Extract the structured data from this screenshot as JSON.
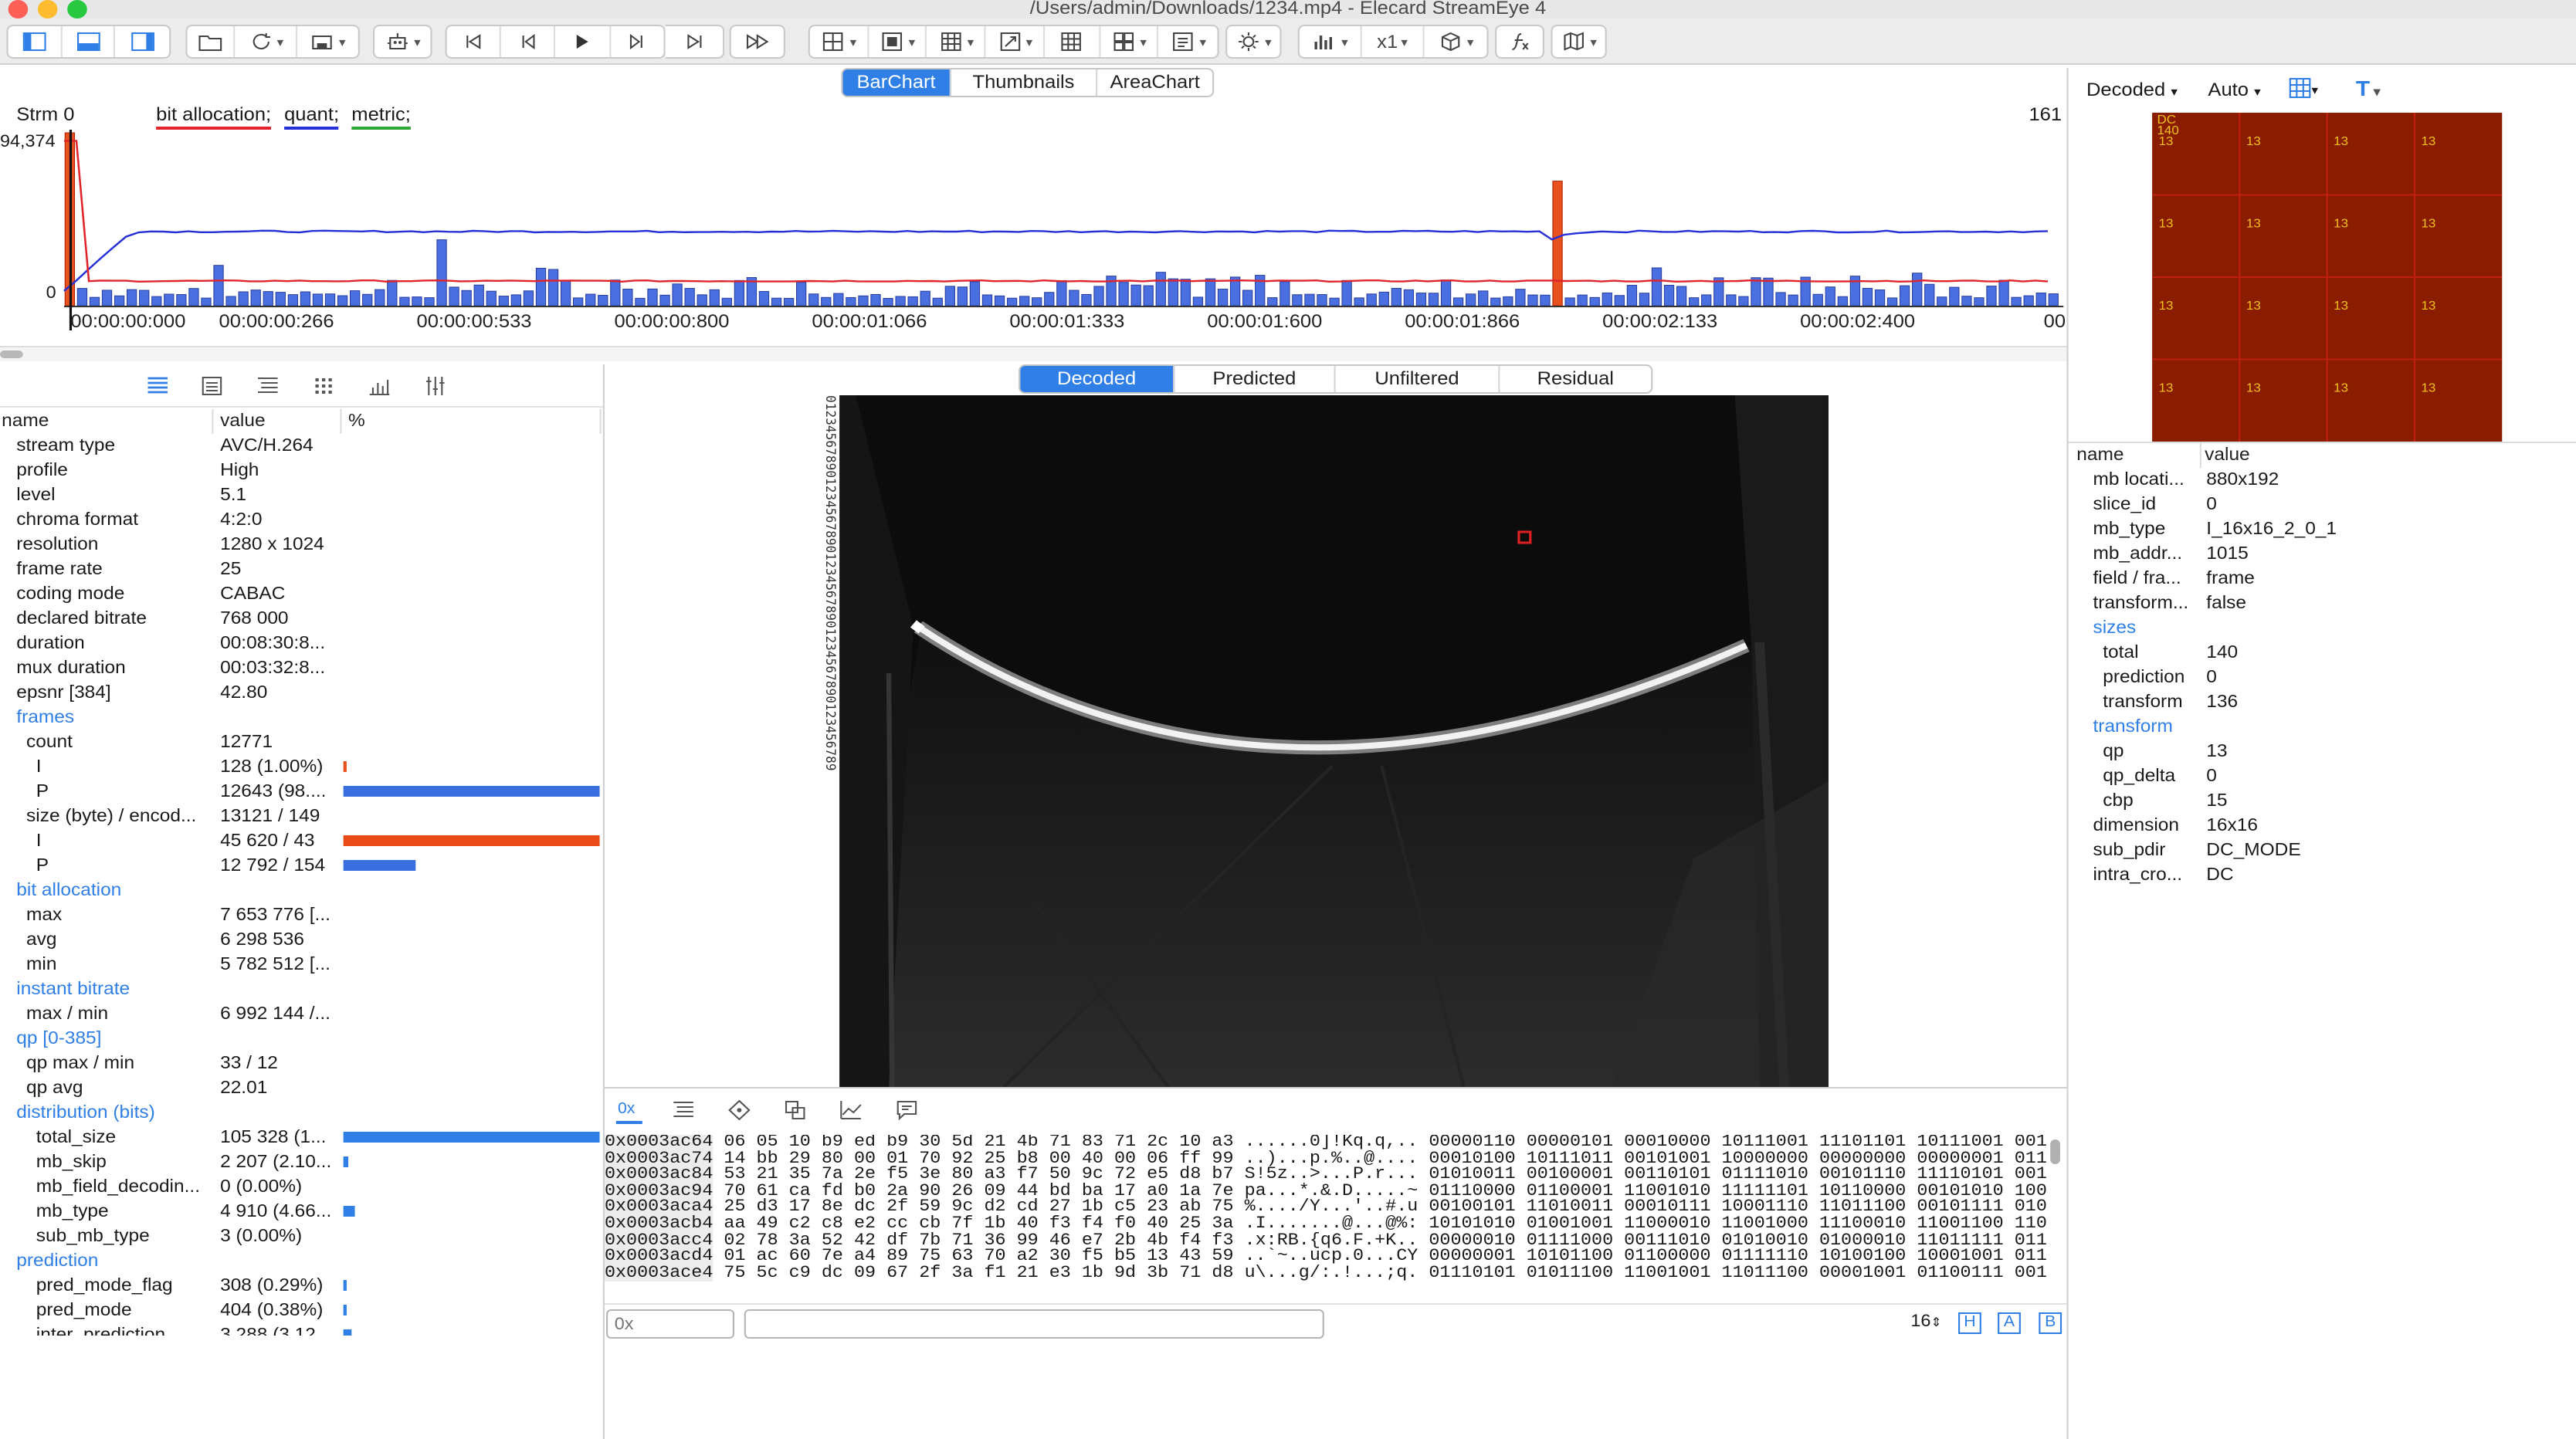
{
  "window": {
    "title": "/Users/admin/Downloads/1234.mp4 - Elecard StreamEye 4"
  },
  "toolbar": {
    "scale_label": "x1"
  },
  "view_tabs": [
    {
      "label": "BarChart",
      "active": true
    },
    {
      "label": "Thumbnails",
      "active": false
    },
    {
      "label": "AreaChart",
      "active": false
    }
  ],
  "chart_header": {
    "stream": "Strm 0",
    "legend": [
      {
        "label": "bit allocation;",
        "color": "#e0242a"
      },
      {
        "label": "quant;",
        "color": "#2630d8"
      },
      {
        "label": "metric;",
        "color": "#2ea836"
      }
    ],
    "frame_total": "161"
  },
  "chart_data": {
    "type": "bar",
    "title": "",
    "y_top_label": "94,374",
    "y_zero_label": "0",
    "x_tick_labels": [
      "00:00:00:000",
      "00:00:00:266",
      "00:00:00:533",
      "00:00:00:800",
      "00:00:01:066",
      "00:00:01:333",
      "00:00:01:600",
      "00:00:01:866",
      "00:00:02:133",
      "00:00:02:400",
      "00"
    ],
    "ylim": [
      0,
      94374
    ],
    "series": [
      {
        "name": "bit allocation",
        "type": "line",
        "approx_value": 13500
      },
      {
        "name": "quant",
        "type": "line",
        "approx_value": 41000
      },
      {
        "name": "metric",
        "type": "line"
      }
    ],
    "i_frames": [
      {
        "frame": 0,
        "value": 94374
      },
      {
        "frame": 120,
        "value": 68000
      }
    ],
    "p_frame_value_range": [
      4000,
      40000
    ],
    "frame_count": 161
  },
  "panel_icons": [
    "table-icon",
    "list-icon",
    "outline-icon",
    "grid-icon",
    "bar-chart-icon",
    "filter-icon"
  ],
  "properties": {
    "headers": {
      "name": "name",
      "value": "value",
      "percent": "%"
    },
    "rows": [
      {
        "n": "stream type",
        "v": "AVC/H.264",
        "i": 1
      },
      {
        "n": "profile",
        "v": "High",
        "i": 1
      },
      {
        "n": "level",
        "v": "5.1",
        "i": 1
      },
      {
        "n": "chroma format",
        "v": "4:2:0",
        "i": 1
      },
      {
        "n": "resolution",
        "v": "1280 x 1024",
        "i": 1
      },
      {
        "n": "frame rate",
        "v": "25",
        "i": 1
      },
      {
        "n": "coding mode",
        "v": "CABAC",
        "i": 1
      },
      {
        "n": "declared bitrate",
        "v": "768 000",
        "i": 1
      },
      {
        "n": "duration",
        "v": "00:08:30:8...",
        "i": 1
      },
      {
        "n": "mux duration",
        "v": "00:03:32:8...",
        "i": 1
      },
      {
        "n": "epsnr [384]",
        "v": "42.80",
        "i": 1
      },
      {
        "n": "frames",
        "v": "",
        "i": 1,
        "sec": true
      },
      {
        "n": "count",
        "v": "12771",
        "i": 2
      },
      {
        "n": "I",
        "v": "128 (1.00%)",
        "i": 3,
        "pct": 1.0,
        "bc": "#e8521e"
      },
      {
        "n": "P",
        "v": "12643 (98....",
        "i": 3,
        "pct": 100,
        "bc": "#3a6fe0"
      },
      {
        "n": "size (byte) / encod...",
        "v": "13121 / 149",
        "i": 2
      },
      {
        "n": "I",
        "v": "45 620 / 43",
        "i": 3,
        "pct": 100,
        "bc": "#e84a18"
      },
      {
        "n": "P",
        "v": "12 792 / 154",
        "i": 3,
        "pct": 28,
        "bc": "#3a6fe0"
      },
      {
        "n": "bit allocation",
        "v": "",
        "i": 1,
        "sec": true
      },
      {
        "n": "max",
        "v": "7 653 776 [...",
        "i": 2
      },
      {
        "n": "avg",
        "v": "6 298 536",
        "i": 2
      },
      {
        "n": "min",
        "v": "5 782 512 [...",
        "i": 2
      },
      {
        "n": "instant bitrate",
        "v": "",
        "i": 1,
        "sec": true
      },
      {
        "n": "max / min",
        "v": "6 992 144 /...",
        "i": 2
      },
      {
        "n": "qp [0-385]",
        "v": "",
        "i": 1,
        "sec": true
      },
      {
        "n": "qp max / min",
        "v": "33 / 12",
        "i": 2
      },
      {
        "n": "qp avg",
        "v": "22.01",
        "i": 2
      },
      {
        "n": "distribution (bits)",
        "v": "",
        "i": 1,
        "sec": true
      },
      {
        "n": "total_size",
        "v": "105 328 (1...",
        "i": 3,
        "pct": 100,
        "bc": "#2f7fe6"
      },
      {
        "n": "mb_skip",
        "v": "2 207 (2.10...",
        "i": 3,
        "pct": 2.1,
        "bc": "#2f7fe6"
      },
      {
        "n": "mb_field_decodin...",
        "v": "0 (0.00%)",
        "i": 3
      },
      {
        "n": "mb_type",
        "v": "4 910 (4.66...",
        "i": 3,
        "pct": 4.66,
        "bc": "#2f7fe6"
      },
      {
        "n": "sub_mb_type",
        "v": "3 (0.00%)",
        "i": 3
      },
      {
        "n": "prediction",
        "v": "",
        "i": 1,
        "sec": true
      },
      {
        "n": "pred_mode_flag",
        "v": "308 (0.29%)",
        "i": 3,
        "pct": 0.29,
        "bc": "#2f7fe6"
      },
      {
        "n": "pred_mode",
        "v": "404 (0.38%)",
        "i": 3,
        "pct": 0.38,
        "bc": "#2f7fe6"
      },
      {
        "n": "inter_prediction",
        "v": "3 288 (3.12...",
        "i": 3,
        "pct": 3.12,
        "bc": "#2f7fe6"
      }
    ]
  },
  "decode_tabs": [
    {
      "label": "Decoded",
      "active": true
    },
    {
      "label": "Predicted",
      "active": false
    },
    {
      "label": "Unfiltered",
      "active": false
    },
    {
      "label": "Residual",
      "active": false
    }
  ],
  "ruler_digits": "01234567890123456789012345678901234567890123456789",
  "hex_view": {
    "lines": [
      {
        "off": "0x0003ac64",
        "hex": "06 05 10 b9 ed b9 30 5d 21 4b 71 83 71 2c 10 a3",
        "asc": "......0]!Kq.q,..",
        "bin": "00000110 00000101 00010000 10111001 11101101 10111001 001"
      },
      {
        "off": "0x0003ac74",
        "hex": "14 bb 29 80 00 01 70 92 25 b8 00 40 00 06 ff 99",
        "asc": "..)...p.%..@....",
        "bin": "00010100 10111011 00101001 10000000 00000000 00000001 011"
      },
      {
        "off": "0x0003ac84",
        "hex": "53 21 35 7a 2e f5 3e 80 a3 f7 50 9c 72 e5 d8 b7",
        "asc": "S!5z..>...P.r...",
        "bin": "01010011 00100001 00110101 01111010 00101110 11110101 001"
      },
      {
        "off": "0x0003ac94",
        "hex": "70 61 ca fd b0 2a 90 26 09 44 bd ba 17 a0 1a 7e",
        "asc": "pa...*.&.D.....~",
        "bin": "01110000 01100001 11001010 11111101 10110000 00101010 100"
      },
      {
        "off": "0x0003aca4",
        "hex": "25 d3 17 8e dc 2f 59 9c d2 cd 27 1b c5 23 ab 75",
        "asc": "%..../Y...'..#.u",
        "bin": "00100101 11010011 00010111 10001110 11011100 00101111 010"
      },
      {
        "off": "0x0003acb4",
        "hex": "aa 49 c2 c8 e2 cc cb 7f 1b 40 f3 f4 f0 40 25 3a",
        "asc": ".I.......@...@%:",
        "bin": "10101010 01001001 11000010 11001000 11100010 11001100 110"
      },
      {
        "off": "0x0003acc4",
        "hex": "02 78 3a 52 42 df 7b 71 36 99 46 e7 2b 4b f4 f3",
        "asc": ".x:RB.{q6.F.+K..",
        "bin": "00000010 01111000 00111010 01010010 01000010 11011111 011"
      },
      {
        "off": "0x0003acd4",
        "hex": "01 ac 60 7e a4 89 75 63 70 a2 30 f5 b5 13 43 59",
        "asc": "..`~..ucp.0...CY",
        "bin": "00000001 10101100 01100000 01111110 10100100 10001001 011"
      },
      {
        "off": "0x0003ace4",
        "hex": "75 5c c9 dc 09 67 2f 3a f1 21 e3 1b 9d 3b 71 d8",
        "asc": "u\\...g/:.!...;q.",
        "bin": "01110101 01011100 11001001 11011100 00001001 01100111 001"
      }
    ]
  },
  "hex_bottom": {
    "offset_placeholder": "0x",
    "search_value": "",
    "bytes_per_line": "16",
    "btn_h": "H",
    "btn_a": "A",
    "btn_b": "B"
  },
  "right_panel": {
    "mode": "Decoded",
    "zoom": "Auto",
    "mb_labels": {
      "dc": "DC",
      "size": "140",
      "qp": "13"
    },
    "headers": {
      "name": "name",
      "value": "value"
    },
    "rows": [
      {
        "n": "mb locati...",
        "v": "880x192",
        "i": 1
      },
      {
        "n": "slice_id",
        "v": "0",
        "i": 1
      },
      {
        "n": "mb_type",
        "v": "I_16x16_2_0_1",
        "i": 1
      },
      {
        "n": "mb_addr...",
        "v": "1015",
        "i": 1
      },
      {
        "n": "field / fra...",
        "v": "frame",
        "i": 1
      },
      {
        "n": "transform...",
        "v": "false",
        "i": 1
      },
      {
        "n": "sizes",
        "v": "",
        "i": 1,
        "sec": true
      },
      {
        "n": "total",
        "v": "140",
        "i": 2
      },
      {
        "n": "prediction",
        "v": "0",
        "i": 2
      },
      {
        "n": "transform",
        "v": "136",
        "i": 2
      },
      {
        "n": "transform",
        "v": "",
        "i": 1,
        "sec": true
      },
      {
        "n": "qp",
        "v": "13",
        "i": 2
      },
      {
        "n": "qp_delta",
        "v": "0",
        "i": 2
      },
      {
        "n": "cbp",
        "v": "15",
        "i": 2
      },
      {
        "n": "dimension",
        "v": "16x16",
        "i": 1
      },
      {
        "n": "sub_pdir",
        "v": "DC_MODE",
        "i": 1
      },
      {
        "n": "intra_cro...",
        "v": "DC",
        "i": 1
      }
    ]
  }
}
